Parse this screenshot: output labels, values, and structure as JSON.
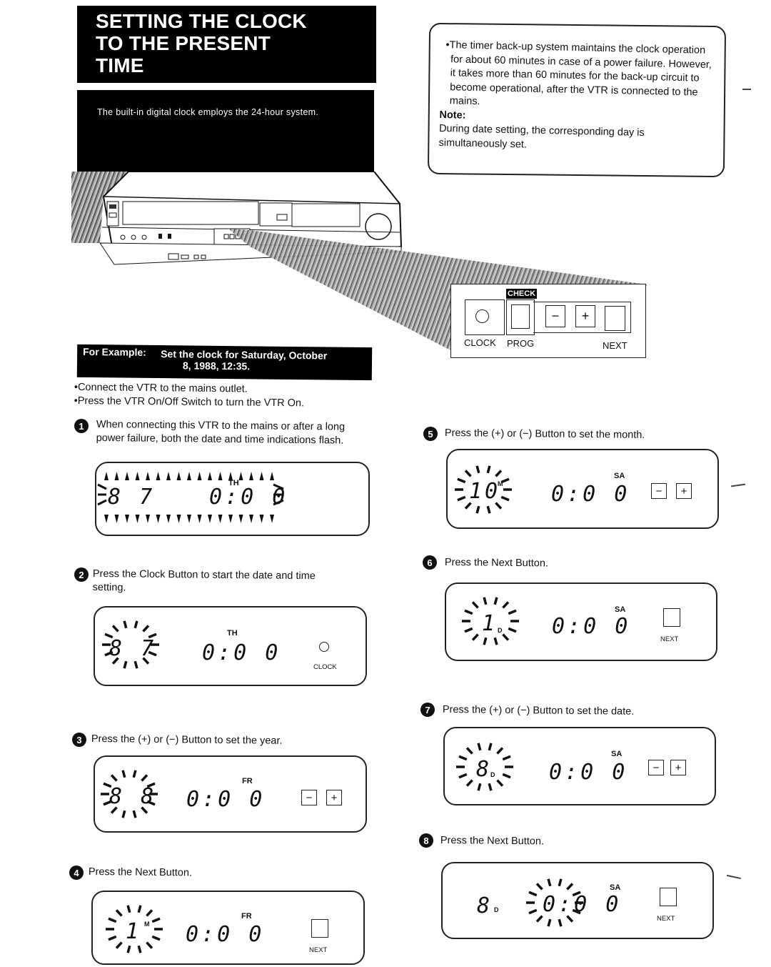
{
  "header": {
    "title_lines": [
      "SETTING THE CLOCK",
      "TO THE PRESENT",
      "TIME"
    ],
    "subtitle": "The built-in digital clock employs the 24-hour system."
  },
  "info_box": {
    "bullet": "•The timer back-up system maintains the clock operation for about 60 minutes in case of a power failure. However, it takes more than 60 minutes for the back-up circuit to become operational, after the VTR is connected to the mains.",
    "note_label": "Note:",
    "note_text": "During date setting, the corresponding day is simultaneously set."
  },
  "control_panel": {
    "check_label": "CHECK",
    "buttons": {
      "clock": "CLOCK",
      "prog": "PROG",
      "minus": "−",
      "plus": "+",
      "next": "NEXT"
    }
  },
  "example": {
    "label": "For Example:",
    "line1": "Set the clock for Saturday, October",
    "line2": "8, 1988, 12:35."
  },
  "prerequisites": [
    "•Connect the VTR to the mains outlet.",
    "•Press the VTR On/Off Switch to turn the VTR On."
  ],
  "steps": [
    {
      "number": "1",
      "text_lines": [
        "When connecting this VTR to the mains or after a long",
        "power failure, both the date and time indications flash."
      ],
      "display": {
        "left": "8 7",
        "time": "0:0 0",
        "day": "TH",
        "flashing": "all",
        "button": "",
        "button_label": ""
      }
    },
    {
      "number": "2",
      "text_lines": [
        "Press the Clock Button to start the date and time",
        "setting."
      ],
      "display": {
        "left": "8 7",
        "time": "0:0 0",
        "day": "TH",
        "flashing": "year",
        "button": "clock",
        "button_label": "CLOCK"
      }
    },
    {
      "number": "3",
      "text_lines": [
        "Press the (+) or (−) Button to set the year."
      ],
      "display": {
        "left": "8 8",
        "time": "0:0 0",
        "day": "FR",
        "flashing": "year",
        "button": "minus-plus",
        "minus": "−",
        "plus": "+"
      }
    },
    {
      "number": "4",
      "text_lines": [
        "Press the Next Button."
      ],
      "display": {
        "left": "1",
        "unit": "M",
        "time": "0:0 0",
        "day": "FR",
        "flashing": "month",
        "button": "next",
        "button_label": "NEXT"
      }
    },
    {
      "number": "5",
      "text_lines": [
        "Press the (+) or (−) Button to set the month."
      ],
      "display": {
        "left": "10",
        "unit": "M",
        "time": "0:0 0",
        "day": "SA",
        "flashing": "month",
        "button": "minus-plus",
        "minus": "−",
        "plus": "+"
      }
    },
    {
      "number": "6",
      "text_lines": [
        "Press the Next Button."
      ],
      "display": {
        "left": "1",
        "unit": "D",
        "time": "0:0 0",
        "day": "SA",
        "flashing": "date",
        "button": "next",
        "button_label": "NEXT"
      }
    },
    {
      "number": "7",
      "text_lines": [
        "Press the (+) or (−) Button to set the date."
      ],
      "display": {
        "left": "8",
        "unit": "D",
        "time": "0:0 0",
        "day": "SA",
        "flashing": "date",
        "button": "minus-plus",
        "minus": "−",
        "plus": "+"
      }
    },
    {
      "number": "8",
      "text_lines": [
        "Press the Next Button."
      ],
      "display": {
        "left": "8",
        "unit": "D",
        "time": "0:0 0",
        "day": "SA",
        "flashing": "hour",
        "button": "next",
        "button_label": "NEXT"
      }
    }
  ]
}
